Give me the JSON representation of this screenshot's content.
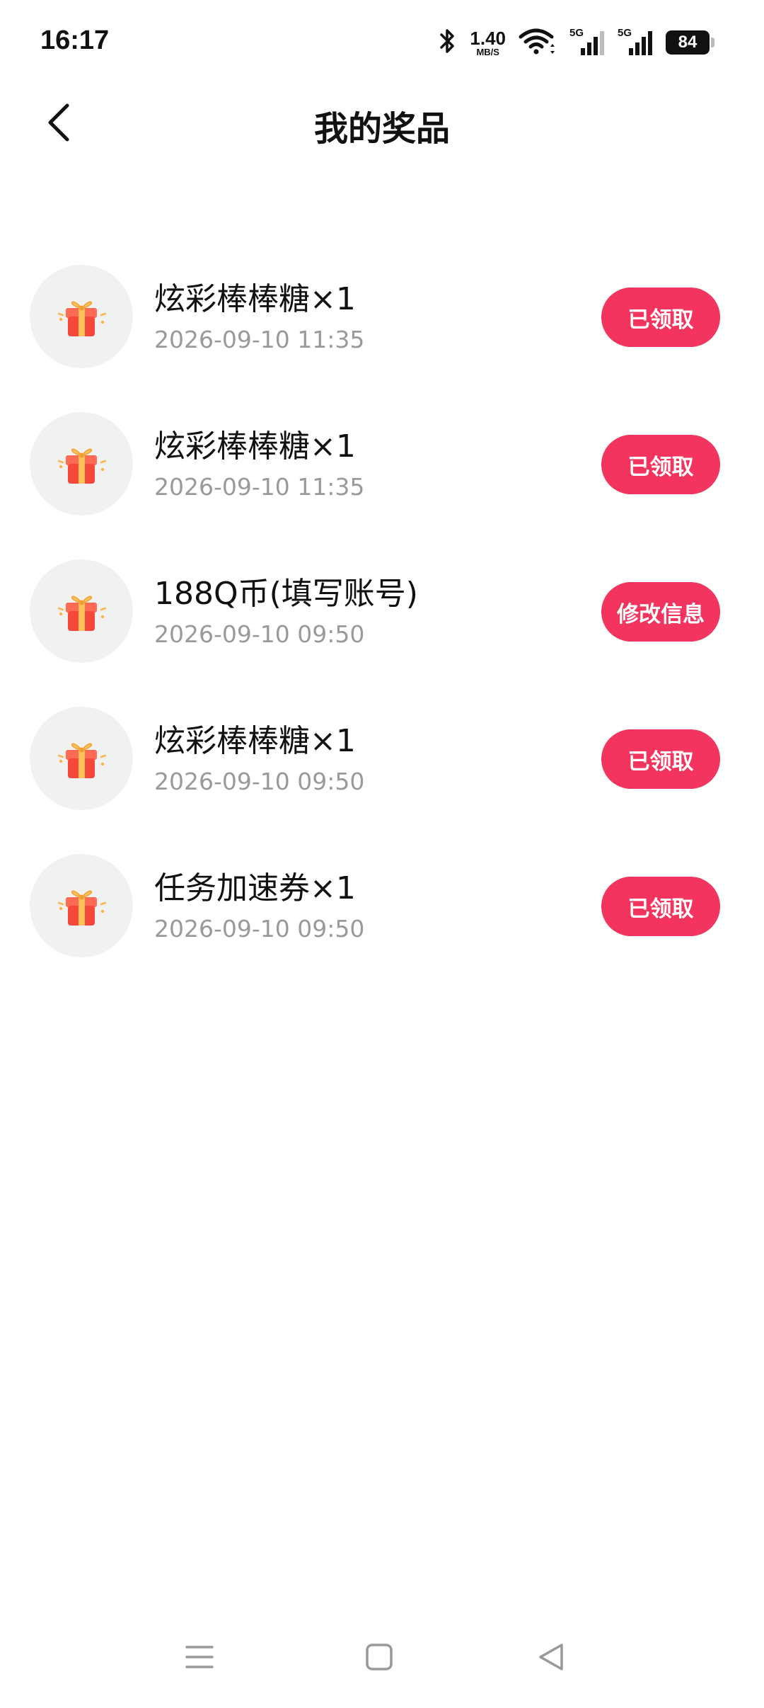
{
  "status_bar": {
    "time": "16:17",
    "net_speed": "1.40",
    "net_speed_unit": "MB/S",
    "sim1": "5G",
    "sim2": "5G",
    "battery": "84",
    "icons": [
      "bluetooth-icon",
      "wifi-icon",
      "cellular-signal-icon",
      "cellular-signal-icon",
      "battery-icon"
    ]
  },
  "header": {
    "back_icon": "chevron-left-icon",
    "title": "我的奖品"
  },
  "colors": {
    "accent": "#f2345e",
    "avatar_bg": "#f1f1f1",
    "time_text": "#9a9a9a"
  },
  "prizes": [
    {
      "name": "炫彩棒棒糖×1",
      "time": "2026-09-10 11:35",
      "action": "已领取",
      "icon": "gift-box-icon"
    },
    {
      "name": "炫彩棒棒糖×1",
      "time": "2026-09-10 11:35",
      "action": "已领取",
      "icon": "gift-box-icon"
    },
    {
      "name": "188Q币(填写账号)",
      "time": "2026-09-10 09:50",
      "action": "修改信息",
      "icon": "gift-box-icon"
    },
    {
      "name": "炫彩棒棒糖×1",
      "time": "2026-09-10 09:50",
      "action": "已领取",
      "icon": "gift-box-icon"
    },
    {
      "name": "任务加速券×1",
      "time": "2026-09-10 09:50",
      "action": "已领取",
      "icon": "gift-box-icon"
    }
  ],
  "nav_bar": {
    "icons": [
      "menu-icon",
      "home-square-icon",
      "back-triangle-icon"
    ]
  }
}
